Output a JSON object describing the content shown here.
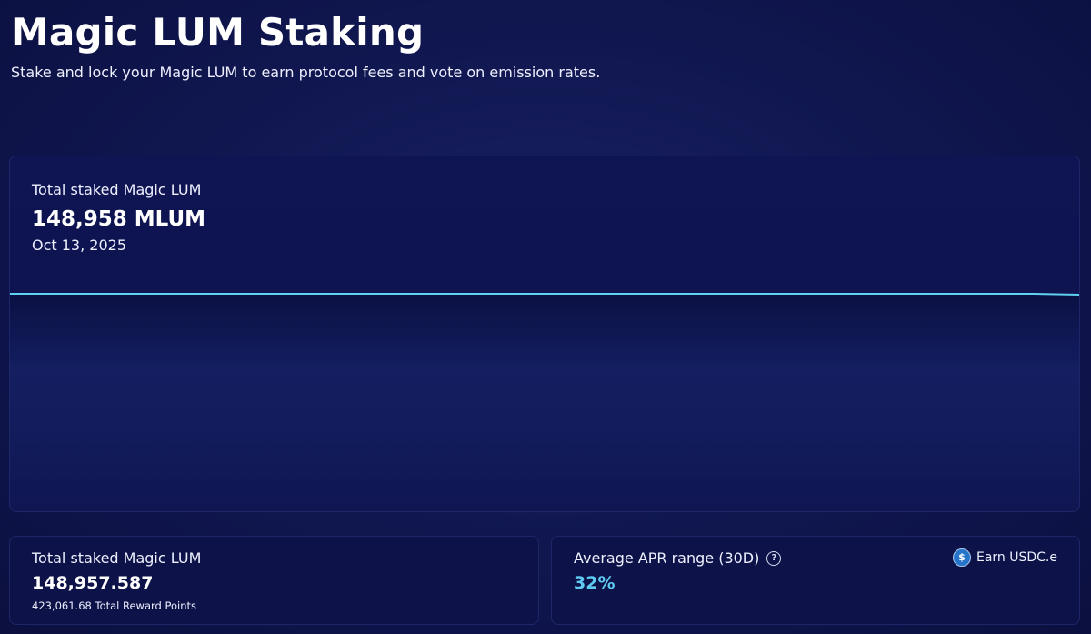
{
  "header": {
    "title": "Magic LUM Staking",
    "subtitle": "Stake and lock your Magic LUM to earn protocol fees and vote on emission rates."
  },
  "chart_card": {
    "label": "Total staked Magic LUM",
    "value": "148,958 MLUM",
    "date": "Oct 13, 2025"
  },
  "chart_data": {
    "type": "area",
    "title": "",
    "xlabel": "",
    "ylabel": "",
    "series": [
      {
        "values": [
          148958,
          148958,
          148958,
          148958,
          148958,
          148958,
          148958,
          148958,
          148958,
          148958,
          148958,
          148958,
          148958,
          148958,
          148958,
          148958,
          148958,
          148958,
          148958,
          148958,
          148958,
          148958,
          148958,
          148957.6
        ]
      }
    ],
    "line_color": "#5fd0f0",
    "grid": false,
    "axes_visible": false
  },
  "stats": {
    "staked": {
      "label": "Total staked Magic LUM",
      "value": "148,957.587",
      "sub": "423,061.68 Total Reward Points"
    },
    "apr": {
      "label": "Average APR range (30D)",
      "help_icon": "?",
      "value": "32%",
      "earn_label": "Earn USDC.e",
      "earn_icon_glyph": "$",
      "accent_color": "#5fcbf2"
    }
  }
}
